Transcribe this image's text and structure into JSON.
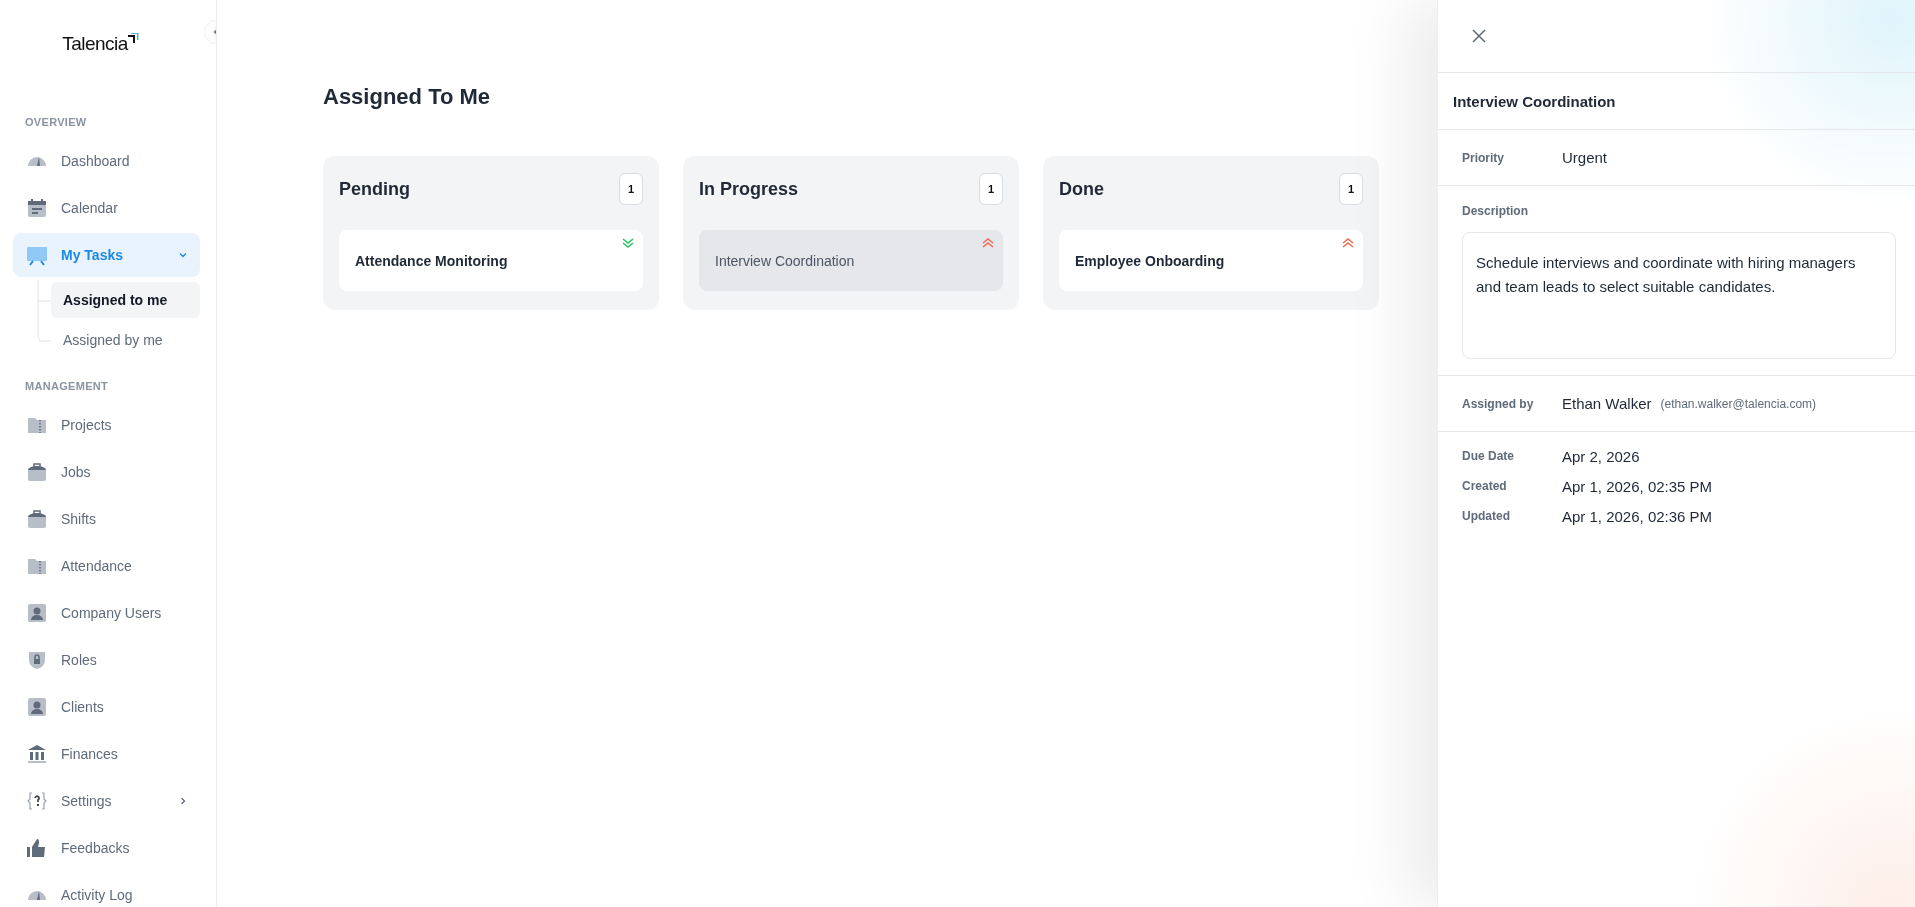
{
  "sidebar": {
    "logo": "Talencia",
    "sections": [
      {
        "heading": "OVERVIEW",
        "items": [
          {
            "label": "Dashboard",
            "selected": false
          },
          {
            "label": "Calendar",
            "selected": false
          },
          {
            "label": "My Tasks",
            "selected": true,
            "expanded": true,
            "children": [
              {
                "label": "Assigned to me",
                "selected": true
              },
              {
                "label": "Assigned by me",
                "selected": false
              }
            ]
          }
        ]
      },
      {
        "heading": "MANAGEMENT",
        "items": [
          {
            "label": "Projects",
            "selected": false
          },
          {
            "label": "Jobs",
            "selected": false
          },
          {
            "label": "Shifts",
            "selected": false
          },
          {
            "label": "Attendance",
            "selected": false
          },
          {
            "label": "Company Users",
            "selected": false
          },
          {
            "label": "Roles",
            "selected": false
          },
          {
            "label": "Clients",
            "selected": false
          },
          {
            "label": "Finances",
            "selected": false
          },
          {
            "label": "Settings",
            "selected": false,
            "expanded": false
          },
          {
            "label": "Feedbacks",
            "selected": false
          },
          {
            "label": "Activity Log",
            "selected": false
          }
        ]
      }
    ]
  },
  "page": {
    "title": "Assigned To Me"
  },
  "columns": [
    {
      "title": "Pending",
      "count": "1",
      "cards": [
        {
          "title": "Attendance Monitoring",
          "high_priority": false,
          "selected": false
        }
      ]
    },
    {
      "title": "In Progress",
      "count": "1",
      "cards": [
        {
          "title": "Interview Coordination",
          "high_priority": true,
          "selected": true
        }
      ]
    },
    {
      "title": "Done",
      "count": "1",
      "cards": [
        {
          "title": "Employee Onboarding",
          "high_priority": true,
          "selected": false
        }
      ]
    }
  ],
  "detail": {
    "title": "Interview Coordination",
    "priority": {
      "label": "Priority",
      "value": "Urgent"
    },
    "description": {
      "label": "Description",
      "value": "Schedule interviews and coordinate with hiring managers and team leads to select suitable candidates."
    },
    "assigned_by": {
      "label": "Assigned by",
      "name": "Ethan Walker",
      "email": "(ethan.walker@talencia.com)"
    },
    "dates": [
      {
        "label": "Due Date",
        "value": "Apr 2, 2026"
      },
      {
        "label": "Created",
        "value": "Apr 1, 2026, 02:35 PM"
      },
      {
        "label": "Updated",
        "value": "Apr 1, 2026, 02:36 PM"
      }
    ]
  }
}
